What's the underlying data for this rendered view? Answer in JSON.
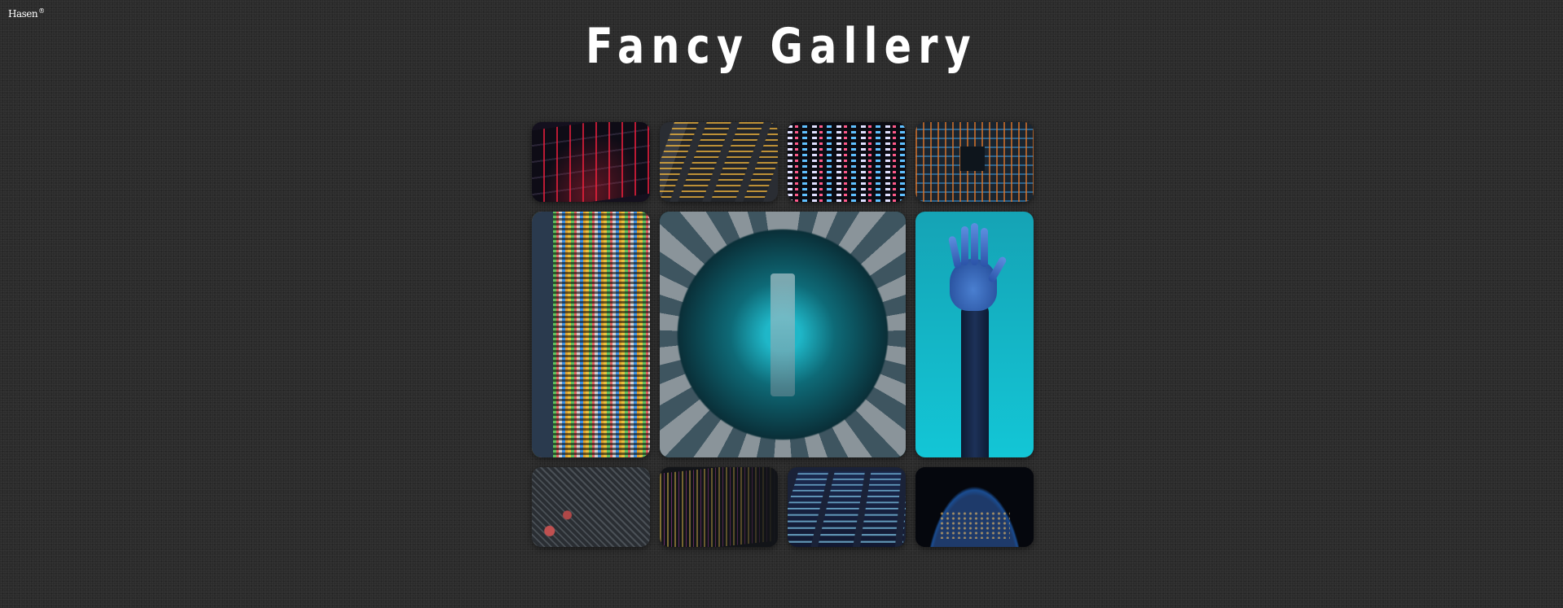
{
  "brand": {
    "name": "Hasen",
    "mark": "®"
  },
  "page": {
    "title": "Fancy Gallery"
  },
  "gallery": {
    "tiles": [
      {
        "subject": "keyboard"
      },
      {
        "subject": "code"
      },
      {
        "subject": "code"
      },
      {
        "subject": "circuit-board"
      },
      {
        "subject": "code"
      },
      {
        "subject": "chamber"
      },
      {
        "subject": "robotic-hand"
      },
      {
        "subject": "motherboard"
      },
      {
        "subject": "code"
      },
      {
        "subject": "laptop"
      },
      {
        "subject": "earth"
      }
    ]
  }
}
